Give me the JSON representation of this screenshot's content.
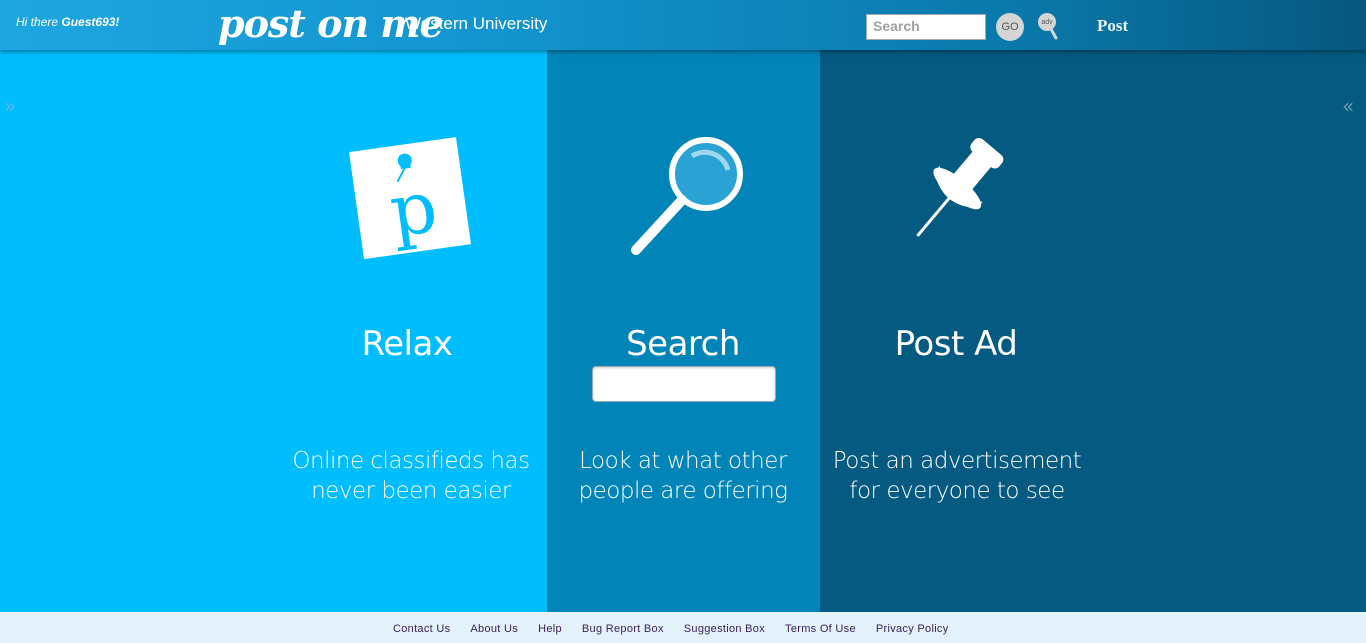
{
  "header": {
    "greeting_prefix": "Hi there",
    "username": "Guest693!",
    "logo": "post on me",
    "university": "Western University",
    "search_placeholder": "Search",
    "go_label": "GO",
    "adv_label": "adv",
    "post_label": "Post"
  },
  "nav": {
    "left_chevron": "»",
    "right_chevron": "«"
  },
  "columns": [
    {
      "title": "Relax",
      "desc_line1": "Online classifieds has",
      "desc_line2": "never been easier",
      "icon": "p-pin-note-icon"
    },
    {
      "title": "Search",
      "desc_line1": "Look at what other",
      "desc_line2": "people are offering",
      "icon": "magnifier-icon"
    },
    {
      "title": "Post Ad",
      "desc_line1": "Post an advertisement",
      "desc_line2": "for everyone to see",
      "icon": "pushpin-icon"
    }
  ],
  "footer": {
    "links": [
      "Contact Us",
      "About Us",
      "Help",
      "Bug Report Box",
      "Suggestion Box",
      "Terms Of Use",
      "Privacy Policy"
    ]
  },
  "colors": {
    "panel_left": "#00bdfd",
    "panel_mid": "#0185b9",
    "panel_right": "#045a80"
  }
}
